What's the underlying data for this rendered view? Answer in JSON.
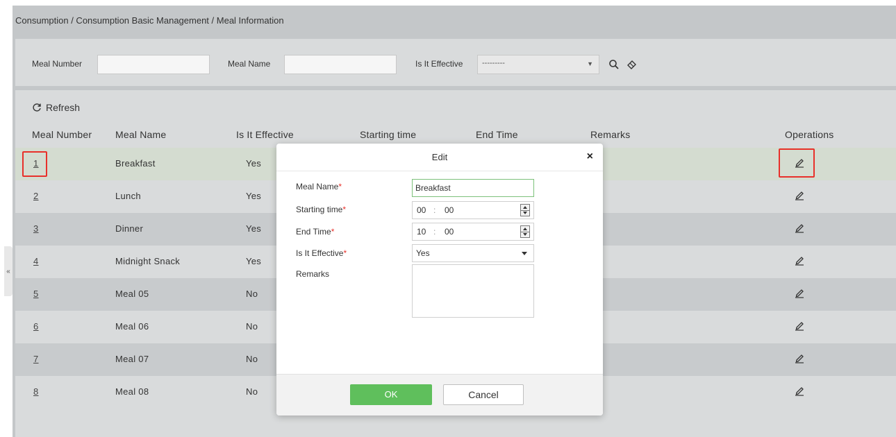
{
  "breadcrumb": "Consumption / Consumption Basic Management / Meal Information",
  "filters": {
    "meal_number_label": "Meal Number",
    "meal_number_value": "",
    "meal_name_label": "Meal Name",
    "meal_name_value": "",
    "effective_label": "Is It Effective",
    "effective_value": "---------",
    "search_icon": "search-icon",
    "clear_icon": "eraser-icon"
  },
  "toolbar": {
    "refresh_label": "Refresh",
    "refresh_icon": "refresh-icon"
  },
  "table": {
    "headers": [
      "Meal Number",
      "Meal Name",
      "Is It Effective",
      "Starting time",
      "End Time",
      "Remarks",
      "Operations"
    ],
    "rows": [
      {
        "number": "1",
        "name": "Breakfast",
        "effective": "Yes"
      },
      {
        "number": "2",
        "name": "Lunch",
        "effective": "Yes"
      },
      {
        "number": "3",
        "name": "Dinner",
        "effective": "Yes"
      },
      {
        "number": "4",
        "name": "Midnight Snack",
        "effective": "Yes"
      },
      {
        "number": "5",
        "name": "Meal 05",
        "effective": "No"
      },
      {
        "number": "6",
        "name": "Meal 06",
        "effective": "No"
      },
      {
        "number": "7",
        "name": "Meal 07",
        "effective": "No"
      },
      {
        "number": "8",
        "name": "Meal 08",
        "effective": "No"
      }
    ],
    "edit_icon": "pencil-icon"
  },
  "sidebar_toggle": "«",
  "modal": {
    "title": "Edit",
    "close": "×",
    "fields": {
      "meal_name_label": "Meal Name",
      "meal_name_value": "Breakfast",
      "start_label": "Starting time",
      "start_hour": "00",
      "start_min": "00",
      "end_label": "End Time",
      "end_hour": "10",
      "end_min": "00",
      "effective_label": "Is It Effective",
      "effective_value": "Yes",
      "remarks_label": "Remarks",
      "remarks_value": ""
    },
    "required_mark": "*",
    "time_sep": ":",
    "ok_label": "OK",
    "cancel_label": "Cancel"
  },
  "colors": {
    "accent_green": "#5fbf5c",
    "highlight_red": "#e8302a",
    "required_red": "#e8302a"
  }
}
